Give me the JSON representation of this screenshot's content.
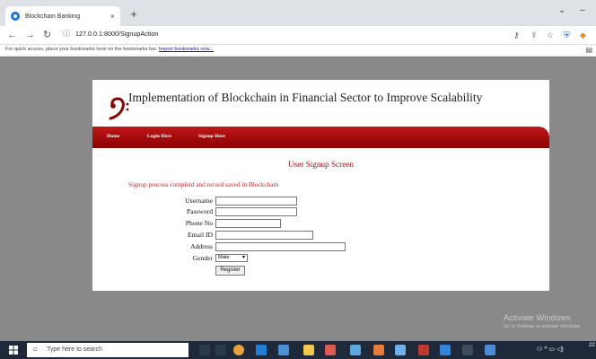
{
  "browser": {
    "tab_title": "Blockchain Banking",
    "tab_close": "×",
    "new_tab": "+",
    "url": "127.0.0.1:8000/SignupAction",
    "bookmarks_text": "For quick access, place your bookmarks here on the bookmarks bar. ",
    "bookmarks_link": "Import bookmarks now..."
  },
  "page": {
    "site_title": "Implementation of Blockchain in Financial Sector to Improve Scalability",
    "nav": [
      "Home",
      "Login Here",
      "Signup Here"
    ],
    "screen_title": "User Signup Screen",
    "status_message": "Signup process completd and record saved in Blockchain",
    "fields": {
      "username": {
        "label": "Username",
        "value": ""
      },
      "password": {
        "label": "Password",
        "value": ""
      },
      "phone": {
        "label": "Phone No",
        "value": ""
      },
      "email": {
        "label": "Email ID",
        "value": ""
      },
      "address": {
        "label": "Address",
        "value": ""
      },
      "gender": {
        "label": "Gender",
        "value": "Male"
      }
    },
    "register_label": "Register"
  },
  "watermark": {
    "line1": "Activate Windows",
    "line2": "Go to Settings to activate Windows."
  },
  "taskbar": {
    "search_placeholder": "Type here to search",
    "clock": "22"
  },
  "colors": {
    "nav_bar": "#b01010",
    "title_red": "#a31515",
    "status_red": "#d0252a",
    "taskbar": "#1e2a3a"
  }
}
